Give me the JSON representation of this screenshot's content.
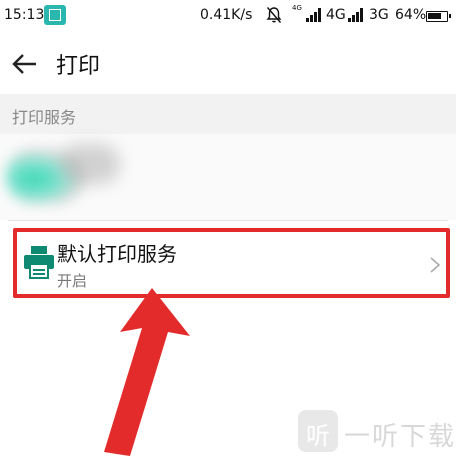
{
  "status_bar": {
    "time": "15:13",
    "speed": "0.41K/s",
    "net_small": "4G",
    "net1": "4G",
    "net2": "3G",
    "battery": "64%"
  },
  "header": {
    "title": "打印"
  },
  "section": {
    "title": "打印服务"
  },
  "print_item": {
    "title": "默认打印服务",
    "status": "开启"
  },
  "watermark": {
    "logo": "听",
    "text": "一听下载"
  },
  "colors": {
    "highlight": "#e32b2b",
    "printer_icon": "#0f8a72",
    "status_icon": "#2ab7b0"
  }
}
